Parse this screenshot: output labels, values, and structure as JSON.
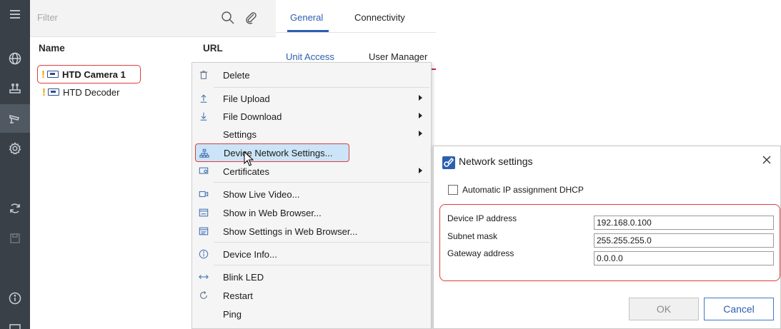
{
  "list": {
    "filter_placeholder": "Filter",
    "col_name": "Name",
    "col_url": "URL",
    "devices": [
      {
        "warning": "!",
        "label": "HTD Camera 1"
      },
      {
        "warning": "!",
        "label": "HTD Decoder"
      }
    ]
  },
  "tabs": {
    "general": "General",
    "connectivity": "Connectivity",
    "unit_access": "Unit Access",
    "user_management": "User Manager"
  },
  "context_menu": {
    "delete": "Delete",
    "file_upload": "File Upload",
    "file_download": "File Download",
    "settings": "Settings",
    "device_network_settings": "Device Network Settings...",
    "certificates": "Certificates",
    "show_live_video": "Show Live Video...",
    "show_in_web_browser": "Show in Web Browser...",
    "show_settings_in_web_browser": "Show Settings in Web Browser...",
    "device_info": "Device Info...",
    "blink_led": "Blink LED",
    "restart": "Restart",
    "ping": "Ping"
  },
  "dialog": {
    "title": "Network settings",
    "dhcp_label": "Automatic IP assignment DHCP",
    "ip_label": "Device IP address",
    "ip_value": "192.168.0.100",
    "mask_label": "Subnet mask",
    "mask_value": "255.255.255.0",
    "gateway_label": "Gateway address",
    "gateway_value": "0.0.0.0",
    "ok": "OK",
    "cancel": "Cancel"
  },
  "colors": {
    "accent": "#2b5fb0",
    "highlight": "#e03c3c",
    "rail": "#3a4048",
    "warning": "#f0a400"
  }
}
